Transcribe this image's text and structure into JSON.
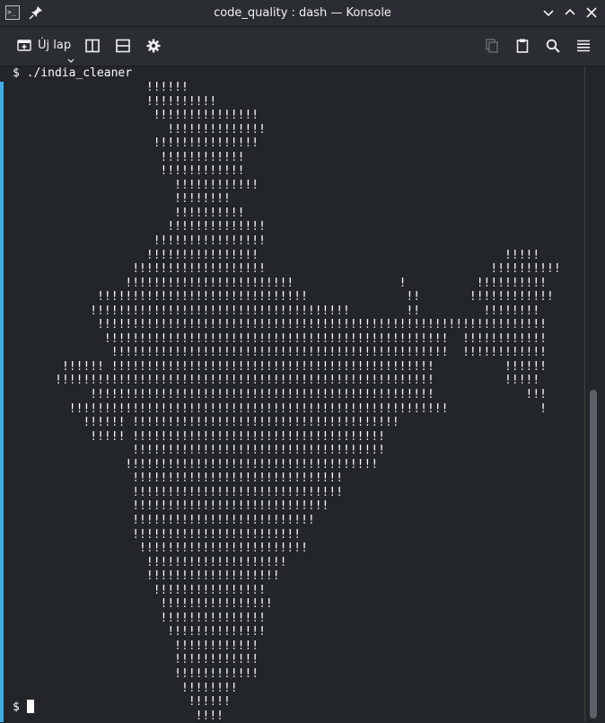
{
  "window": {
    "title": "code_quality : dash — Konsole"
  },
  "toolbar": {
    "new_tab_label": "Új lap",
    "icons": [
      "new-tab-icon",
      "split-left-right-icon",
      "split-top-bottom-icon",
      "settings-icon",
      "copy-icon",
      "paste-icon",
      "search-icon",
      "menu-icon"
    ]
  },
  "terminal": {
    "command_line": "$ ./india_cleaner",
    "output": "                  !!!!!!\n                  !!!!!!!!!!\n                   !!!!!!!!!!!!!!!\n                     !!!!!!!!!!!!!!\n                   !!!!!!!!!!!!!!!\n                    !!!!!!!!!!!!\n                    !!!!!!!!!!!!\n                      !!!!!!!!!!!!\n                      !!!!!!!!\n                      !!!!!!!!!!\n                     !!!!!!!!!!!!!!\n                   !!!!!!!!!!!!!!!!\n                  !!!!!!!!!!!!!!!!                                   !!!!!\n                !!!!!!!!!!!!!!!!!!!                                !!!!!!!!!!\n               !!!!!!!!!!!!!!!!!!!!!!!!               !          !!!!!!!!!!\n           !!!!!!!!!!!!!!!!!!!!!!!!!!!!!!              !!       !!!!!!!!!!!!\n          !!!!!!!!!!!!!!!!!!!!!!!!!!!!!!!!!!!!!        !!         !!!!!!!!\n           !!!!!!!!!!!!!!!!!!!!!!!!!!!!!!!!!!!!!!!!!!!!!!!!!!!!!!!!!!!!!!!!\n            !!!!!!!!!!!!!!!!!!!!!!!!!!!!!!!!!!!!!!!!!!!!!!!!!  !!!!!!!!!!!!\n             !!!!!!!!!!!!!!!!!!!!!!!!!!!!!!!!!!!!!!!!!!!!!!!!  !!!!!!!!!!!!\n      !!!!!! !!!!!!!!!!!!!!!!!!!!!!!!!!!!!!!!!!!!!!!!!!!!!!          !!!!!!\n     !!!!!!!!!!!!!!!!!!!!!!!!!!!!!!!!!!!!!!!!!!!!!!!!!!!!!!          !!!!!\n          !!!!!!!!!!!!!!!!!!!!!!!!!!!!!!!!!!!!!!!!!!!!!!!!!             !!!\n       !!!!!!!!!!!!!!!!!!!!!!!!!!!!!!!!!!!!!!!!!!!!!!!!!!!!!!             !\n         !!!!!! !!!!!!!!!!!!!!!!!!!!!!!!!!!!!!!!!!!!!!\n          !!!!! !!!!!!!!!!!!!!!!!!!!!!!!!!!!!!!!!!!!\n                !!!!!!!!!!!!!!!!!!!!!!!!!!!!!!!!!!!!\n               !!!!!!!!!!!!!!!!!!!!!!!!!!!!!!!!!!!!\n                !!!!!!!!!!!!!!!!!!!!!!!!!!!!!!\n                !!!!!!!!!!!!!!!!!!!!!!!!!!!!!!\n                !!!!!!!!!!!!!!!!!!!!!!!!!!!!\n                !!!!!!!!!!!!!!!!!!!!!!!!!!\n                !!!!!!!!!!!!!!!!!!!!!!!!\n                 !!!!!!!!!!!!!!!!!!!!!!!!\n                  !!!!!!!!!!!!!!!!!!!!\n                  !!!!!!!!!!!!!!!!!!!\n                   !!!!!!!!!!!!!!!!\n                    !!!!!!!!!!!!!!!!\n                    !!!!!!!!!!!!!!!\n                     !!!!!!!!!!!!!!\n                      !!!!!!!!!!!!\n                      !!!!!!!!!!!!\n                      !!!!!!!!!!!!\n                       !!!!!!!!\n                        !!!!!!\n                         !!!!",
    "prompt": "$ "
  }
}
